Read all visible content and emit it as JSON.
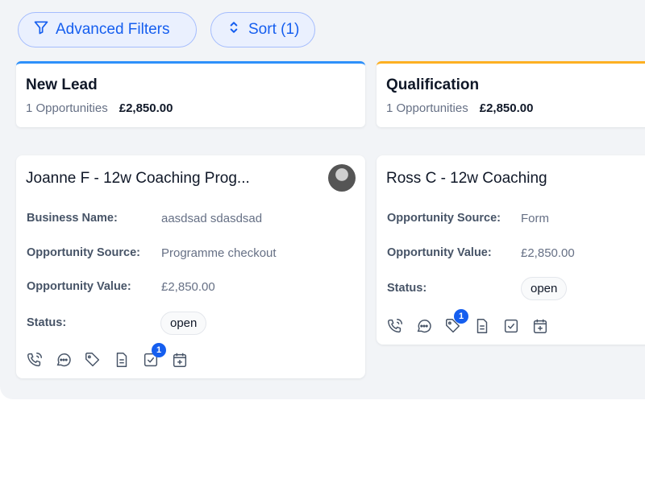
{
  "toolbar": {
    "filters_label": "Advanced Filters",
    "sort_label": "Sort (1)"
  },
  "colors": {
    "accent": "#155eef",
    "stage_new_lead": "#2e90fa",
    "stage_qualification": "#fdb022"
  },
  "columns": [
    {
      "title": "New Lead",
      "count_text": "1 Opportunities",
      "amount": "£2,850.00",
      "card": {
        "title": "Joanne F - 12w Coaching Prog...",
        "fields": [
          {
            "label": "Business Name:",
            "value": "aasdsad sdasdsad"
          },
          {
            "label": "Opportunity Source:",
            "value": "Programme checkout"
          },
          {
            "label": "Opportunity Value:",
            "value": "£2,850.00"
          }
        ],
        "status_label": "Status:",
        "status": "open",
        "task_badge": "1"
      }
    },
    {
      "title": "Qualification",
      "count_text": "1 Opportunities",
      "amount": "£2,850.00",
      "card": {
        "title": "Ross C - 12w Coaching",
        "fields": [
          {
            "label": "Opportunity Source:",
            "value": "Form"
          },
          {
            "label": "Opportunity Value:",
            "value": "£2,850.00"
          }
        ],
        "status_label": "Status:",
        "status": "open",
        "tag_badge": "1"
      }
    }
  ]
}
